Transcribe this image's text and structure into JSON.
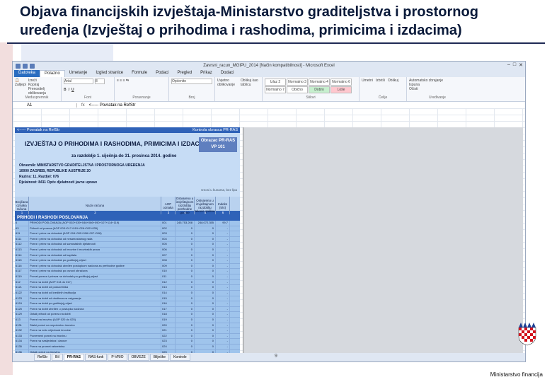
{
  "slide": {
    "title_line1": "Objava financijskih izvještaja-Ministarstvo graditeljstva i prostornog",
    "title_line2": "uređenja (Izvještaj o prihodima i rashodima, primicima i izdacima)",
    "footer": "Ministarstvo financija",
    "page_number": "9"
  },
  "excel": {
    "window_title": "Zavrsni_racun_MGIPU_2014 [Način kompatibilnosti] - Microsoft Excel",
    "tabs": [
      "Datoteka",
      "Polazno",
      "Umetanje",
      "Izgled stranice",
      "Formule",
      "Podaci",
      "Pregled",
      "Prikaz",
      "Dodaci"
    ],
    "ribbon": {
      "paste": "Zalijepi",
      "cut": "Izreži",
      "copy": "Kopiraj",
      "format_painter": "Prenositelj oblikovanja",
      "clipboard": "Međuspremnik",
      "font_name": "Arial",
      "font_size": "8",
      "font_group": "Font",
      "alignment_group": "Poravnanje",
      "number_format": "Općenito",
      "number_group": "Broj",
      "cond_format": "Uvjetno oblikovanje",
      "format_table": "Oblikuj kao tablicu",
      "styles": [
        "Izlaz 2",
        "Normalno 3",
        "Normalno 4",
        "Normalno 6",
        "Normalno 7",
        "Obično",
        "Normalno",
        "Dobro",
        "Loše"
      ],
      "styles_group": "Stilovi",
      "insert": "Umetni",
      "delete": "Izbriši",
      "format": "Oblikuj",
      "cells_group": "Ćelije",
      "autosum": "Automatsko zbrajanje",
      "fill": "Ispuna",
      "clear": "Očisti",
      "sort": "Sortiraj i filtriraj",
      "find": "Pronađi i odaberi",
      "editing_group": "Uređivanje"
    },
    "name_box": "A1",
    "formula": "<----- Povratak na RefStr",
    "sheet_tabs": [
      "RefStr",
      "Bil",
      "PR-RAS",
      "RAS-funk",
      "P-VRIO",
      "OBVEZE",
      "Bilješke",
      "Kontrole"
    ]
  },
  "report": {
    "back_link": "<----- Povratak na RefStr",
    "control_link": "Kontrola obrasca PR-RAS",
    "title": "IZVJEŠTAJ O PRIHODIMA I RASHODIMA, PRIMICIMA I IZDACIMA",
    "period": "za razdoblje 1. siječnja do 31. prosinca 2014. godine",
    "form_box": "Obrazac PR-RAS VP 101",
    "info": [
      "Obveznik: MINISTARSTVO GRADITELJSTVA I PROSTORNOGA UREĐENJA",
      "10000 ZAGREB, REPUBLIKE AUSTRIJE 20",
      "Razina: 11, Razdjel: 076",
      "Djelatnost: 8411 Opće djelatnosti javne uprave"
    ],
    "note": "Iznosi u kunama, bez lipa",
    "headers": [
      "Brojčana oznaka računa",
      "Naziv računa",
      "AOP oznaka",
      "Ostvareno u izvještajnom razdoblju prethodne godine",
      "Ostvareno u izvještajnom razdoblju tekuće godine",
      "Indeks (5/4)"
    ],
    "col_numbers": [
      "1",
      "2",
      "3",
      "4",
      "5",
      "6"
    ],
    "section": "PRIHODI I RASHODI POSLOVANJA",
    "rows": [
      [
        "6",
        "PRIHODI POSLOVANJA (AOP 002+039+046+066+090+107+114+119)",
        "001",
        "245.753.208",
        "248.072.355",
        "99,7"
      ],
      [
        "63",
        "Prihodi od poreza (AOP 003+017+019+026+032+035)",
        "002",
        "0",
        "0",
        "-"
      ],
      [
        "611",
        "Porez i prirez na dohodak (AOP 004+005+006+007+008)",
        "003",
        "0",
        "0",
        "-"
      ],
      [
        "6111",
        "Porez i prirez na dohodak od nesamostalnog rada",
        "004",
        "0",
        "0",
        "-"
      ],
      [
        "6112",
        "Porez i prirez na dohodak od samostalnih djelatnosti",
        "005",
        "0",
        "0",
        "-"
      ],
      [
        "6113",
        "Porez i prirez na dohodak od imovine i imovinskih prava",
        "006",
        "0",
        "0",
        "-"
      ],
      [
        "6114",
        "Porez i prirez na dohodak od kapitala",
        "007",
        "0",
        "0",
        "-"
      ],
      [
        "6115",
        "Porez i prirez na dohodak po godišnjoj prijavi",
        "008",
        "0",
        "0",
        "-"
      ],
      [
        "6116",
        "Porez i prirez na dohodak utvrđen postupkom nadzora za prethodne godine",
        "009",
        "0",
        "0",
        "-"
      ],
      [
        "6117",
        "Porez i prirez na dohodak po osnovi obračuna",
        "010",
        "0",
        "0",
        "-"
      ],
      [
        "6119",
        "Povrat poreza i prireza na dohodak po godišnjoj prijavi",
        "011",
        "0",
        "0",
        "-"
      ],
      [
        "612",
        "Porez na dobit (AOP 013 do 017)",
        "012",
        "0",
        "0",
        "-"
      ],
      [
        "6121",
        "Porez na dobit od poduzetnika",
        "013",
        "0",
        "0",
        "-"
      ],
      [
        "6122",
        "Porez na dobit od kreditnih institucija",
        "014",
        "0",
        "0",
        "-"
      ],
      [
        "6123",
        "Porez na dobit od društava za osiguranje",
        "015",
        "0",
        "0",
        "-"
      ],
      [
        "6124",
        "Porez na dobit po godišnjoj prijavi",
        "016",
        "0",
        "0",
        "-"
      ],
      [
        "6125",
        "Porez na dobit utvrđen u postupku nadzora",
        "017",
        "0",
        "0",
        "-"
      ],
      [
        "6129",
        "Ostali prihodi od poreza na dobit",
        "018",
        "0",
        "0",
        "-"
      ],
      [
        "613",
        "Porezi na imovinu (AOP 020 do 025)",
        "019",
        "0",
        "0",
        "-"
      ],
      [
        "6131",
        "Stalni porezi na nepokretnu imovinu",
        "020",
        "0",
        "0",
        "-"
      ],
      [
        "6132",
        "Porez na neto vrijednost imovine",
        "021",
        "0",
        "0",
        "-"
      ],
      [
        "6133",
        "Povremeni porezi na imovinu",
        "022",
        "0",
        "0",
        "-"
      ],
      [
        "6134",
        "Porez na nasljedstva i darove",
        "023",
        "0",
        "0",
        "-"
      ],
      [
        "6135",
        "Porez na promet nekretnina",
        "024",
        "0",
        "0",
        "-"
      ],
      [
        "6136",
        "Ostali porezi na imovinu",
        "025",
        "0",
        "0",
        "-"
      ],
      [
        "614",
        "Porezi na robu i usluge (AOP 027 do 031)",
        "026",
        "0",
        "0",
        "-"
      ],
      [
        "6141",
        "Porez na dodanu vrijednost",
        "027",
        "0",
        "0",
        "-"
      ],
      [
        "6142",
        "Porez na promet",
        "028",
        "0",
        "0",
        "-"
      ]
    ]
  }
}
